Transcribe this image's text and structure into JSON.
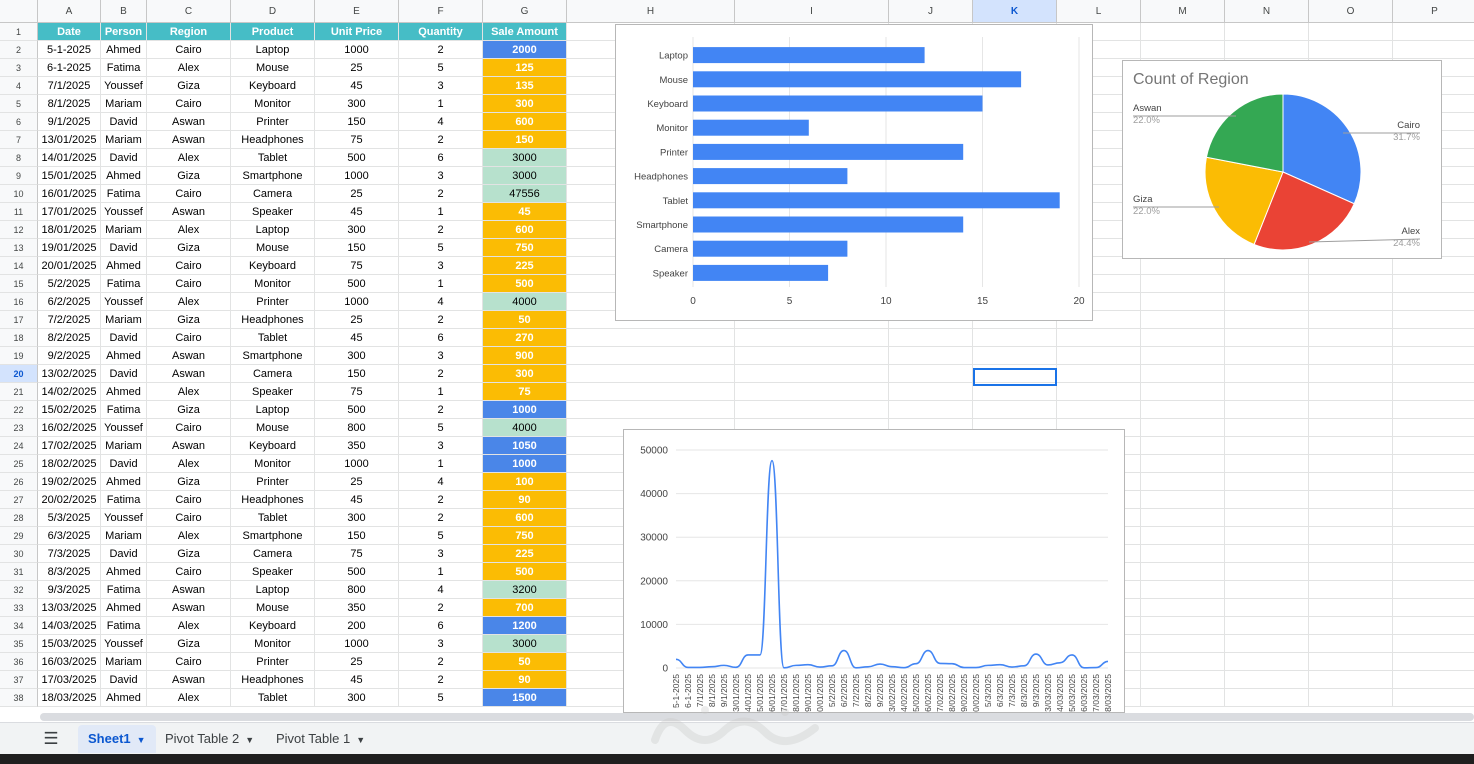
{
  "columns": [
    "A",
    "B",
    "C",
    "D",
    "E",
    "F",
    "G",
    "H",
    "I",
    "J",
    "K",
    "L",
    "M",
    "N",
    "O",
    "P"
  ],
  "selected_column": "K",
  "selected_row": "20",
  "headers": [
    "Date",
    "Person",
    "Region",
    "Product",
    "Unit Price",
    "Quantity",
    "Sale Amount"
  ],
  "rows": [
    {
      "date": "5-1-2025",
      "person": "Ahmed",
      "region": "Cairo",
      "product": "Laptop",
      "price": "1000",
      "qty": "2",
      "amount": "2000",
      "color": "blue"
    },
    {
      "date": "6-1-2025",
      "person": "Fatima",
      "region": "Alex",
      "product": "Mouse",
      "price": "25",
      "qty": "5",
      "amount": "125",
      "color": "orange"
    },
    {
      "date": "7/1/2025",
      "person": "Youssef",
      "region": "Giza",
      "product": "Keyboard",
      "price": "45",
      "qty": "3",
      "amount": "135",
      "color": "orange"
    },
    {
      "date": "8/1/2025",
      "person": "Mariam",
      "region": "Cairo",
      "product": "Monitor",
      "price": "300",
      "qty": "1",
      "amount": "300",
      "color": "orange"
    },
    {
      "date": "9/1/2025",
      "person": "David",
      "region": "Aswan",
      "product": "Printer",
      "price": "150",
      "qty": "4",
      "amount": "600",
      "color": "orange"
    },
    {
      "date": "13/01/2025",
      "person": "Mariam",
      "region": "Aswan",
      "product": "Headphones",
      "price": "75",
      "qty": "2",
      "amount": "150",
      "color": "orange"
    },
    {
      "date": "14/01/2025",
      "person": "David",
      "region": "Alex",
      "product": "Tablet",
      "price": "500",
      "qty": "6",
      "amount": "3000",
      "color": "green"
    },
    {
      "date": "15/01/2025",
      "person": "Ahmed",
      "region": "Giza",
      "product": "Smartphone",
      "price": "1000",
      "qty": "3",
      "amount": "3000",
      "color": "green"
    },
    {
      "date": "16/01/2025",
      "person": "Fatima",
      "region": "Cairo",
      "product": "Camera",
      "price": "25",
      "qty": "2",
      "amount": "47556",
      "color": "green"
    },
    {
      "date": "17/01/2025",
      "person": "Youssef",
      "region": "Aswan",
      "product": "Speaker",
      "price": "45",
      "qty": "1",
      "amount": "45",
      "color": "orange"
    },
    {
      "date": "18/01/2025",
      "person": "Mariam",
      "region": "Alex",
      "product": "Laptop",
      "price": "300",
      "qty": "2",
      "amount": "600",
      "color": "orange"
    },
    {
      "date": "19/01/2025",
      "person": "David",
      "region": "Giza",
      "product": "Mouse",
      "price": "150",
      "qty": "5",
      "amount": "750",
      "color": "orange"
    },
    {
      "date": "20/01/2025",
      "person": "Ahmed",
      "region": "Cairo",
      "product": "Keyboard",
      "price": "75",
      "qty": "3",
      "amount": "225",
      "color": "orange"
    },
    {
      "date": "5/2/2025",
      "person": "Fatima",
      "region": "Cairo",
      "product": "Monitor",
      "price": "500",
      "qty": "1",
      "amount": "500",
      "color": "orange"
    },
    {
      "date": "6/2/2025",
      "person": "Youssef",
      "region": "Alex",
      "product": "Printer",
      "price": "1000",
      "qty": "4",
      "amount": "4000",
      "color": "green"
    },
    {
      "date": "7/2/2025",
      "person": "Mariam",
      "region": "Giza",
      "product": "Headphones",
      "price": "25",
      "qty": "2",
      "amount": "50",
      "color": "orange"
    },
    {
      "date": "8/2/2025",
      "person": "David",
      "region": "Cairo",
      "product": "Tablet",
      "price": "45",
      "qty": "6",
      "amount": "270",
      "color": "orange"
    },
    {
      "date": "9/2/2025",
      "person": "Ahmed",
      "region": "Aswan",
      "product": "Smartphone",
      "price": "300",
      "qty": "3",
      "amount": "900",
      "color": "orange"
    },
    {
      "date": "13/02/2025",
      "person": "David",
      "region": "Aswan",
      "product": "Camera",
      "price": "150",
      "qty": "2",
      "amount": "300",
      "color": "orange"
    },
    {
      "date": "14/02/2025",
      "person": "Ahmed",
      "region": "Alex",
      "product": "Speaker",
      "price": "75",
      "qty": "1",
      "amount": "75",
      "color": "orange"
    },
    {
      "date": "15/02/2025",
      "person": "Fatima",
      "region": "Giza",
      "product": "Laptop",
      "price": "500",
      "qty": "2",
      "amount": "1000",
      "color": "blue"
    },
    {
      "date": "16/02/2025",
      "person": "Youssef",
      "region": "Cairo",
      "product": "Mouse",
      "price": "800",
      "qty": "5",
      "amount": "4000",
      "color": "green"
    },
    {
      "date": "17/02/2025",
      "person": "Mariam",
      "region": "Aswan",
      "product": "Keyboard",
      "price": "350",
      "qty": "3",
      "amount": "1050",
      "color": "blue"
    },
    {
      "date": "18/02/2025",
      "person": "David",
      "region": "Alex",
      "product": "Monitor",
      "price": "1000",
      "qty": "1",
      "amount": "1000",
      "color": "blue"
    },
    {
      "date": "19/02/2025",
      "person": "Ahmed",
      "region": "Giza",
      "product": "Printer",
      "price": "25",
      "qty": "4",
      "amount": "100",
      "color": "orange"
    },
    {
      "date": "20/02/2025",
      "person": "Fatima",
      "region": "Cairo",
      "product": "Headphones",
      "price": "45",
      "qty": "2",
      "amount": "90",
      "color": "orange"
    },
    {
      "date": "5/3/2025",
      "person": "Youssef",
      "region": "Cairo",
      "product": "Tablet",
      "price": "300",
      "qty": "2",
      "amount": "600",
      "color": "orange"
    },
    {
      "date": "6/3/2025",
      "person": "Mariam",
      "region": "Alex",
      "product": "Smartphone",
      "price": "150",
      "qty": "5",
      "amount": "750",
      "color": "orange"
    },
    {
      "date": "7/3/2025",
      "person": "David",
      "region": "Giza",
      "product": "Camera",
      "price": "75",
      "qty": "3",
      "amount": "225",
      "color": "orange"
    },
    {
      "date": "8/3/2025",
      "person": "Ahmed",
      "region": "Cairo",
      "product": "Speaker",
      "price": "500",
      "qty": "1",
      "amount": "500",
      "color": "orange"
    },
    {
      "date": "9/3/2025",
      "person": "Fatima",
      "region": "Aswan",
      "product": "Laptop",
      "price": "800",
      "qty": "4",
      "amount": "3200",
      "color": "green"
    },
    {
      "date": "13/03/2025",
      "person": "Ahmed",
      "region": "Aswan",
      "product": "Mouse",
      "price": "350",
      "qty": "2",
      "amount": "700",
      "color": "orange"
    },
    {
      "date": "14/03/2025",
      "person": "Fatima",
      "region": "Alex",
      "product": "Keyboard",
      "price": "200",
      "qty": "6",
      "amount": "1200",
      "color": "blue"
    },
    {
      "date": "15/03/2025",
      "person": "Youssef",
      "region": "Giza",
      "product": "Monitor",
      "price": "1000",
      "qty": "3",
      "amount": "3000",
      "color": "green"
    },
    {
      "date": "16/03/2025",
      "person": "Mariam",
      "region": "Cairo",
      "product": "Printer",
      "price": "25",
      "qty": "2",
      "amount": "50",
      "color": "orange"
    },
    {
      "date": "17/03/2025",
      "person": "David",
      "region": "Aswan",
      "product": "Headphones",
      "price": "45",
      "qty": "2",
      "amount": "90",
      "color": "orange"
    },
    {
      "date": "18/03/2025",
      "person": "Ahmed",
      "region": "Alex",
      "product": "Tablet",
      "price": "300",
      "qty": "5",
      "amount": "1500",
      "color": "blue"
    }
  ],
  "colors": {
    "blue": "#4a86e8",
    "orange": "#fbbc04",
    "green": "#b7e1cd",
    "header": "#46bdc6",
    "chart_blue": "#4285f4",
    "chart_red": "#ea4335",
    "chart_yellow": "#fbbc04",
    "chart_green": "#34a853"
  },
  "chart_data": [
    {
      "type": "bar",
      "orientation": "horizontal",
      "categories": [
        "Laptop",
        "Mouse",
        "Keyboard",
        "Monitor",
        "Printer",
        "Headphones",
        "Tablet",
        "Smartphone",
        "Camera",
        "Speaker"
      ],
      "values": [
        12,
        17,
        15,
        6,
        14,
        8,
        19,
        14,
        8,
        7
      ],
      "xlim": [
        0,
        20
      ],
      "xticks": [
        "0",
        "5",
        "10",
        "15",
        "20"
      ],
      "grid": true
    },
    {
      "type": "pie",
      "title": "Count of Region",
      "slices": [
        {
          "label": "Cairo",
          "percent_label": "31.7%",
          "value": 31.7,
          "color": "#4285f4"
        },
        {
          "label": "Alex",
          "percent_label": "24.4%",
          "value": 24.4,
          "color": "#ea4335"
        },
        {
          "label": "Giza",
          "percent_label": "22.0%",
          "value": 22.0,
          "color": "#fbbc04"
        },
        {
          "label": "Aswan",
          "percent_label": "22.0%",
          "value": 22.0,
          "color": "#34a853"
        }
      ]
    },
    {
      "type": "line",
      "smooth": true,
      "ylim": [
        0,
        50000
      ],
      "yticks": [
        "0",
        "10000",
        "20000",
        "30000",
        "40000",
        "50000"
      ],
      "x": [
        "5-1-2025",
        "6-1-2025",
        "7/1/2025",
        "8/1/2025",
        "9/1/2025",
        "13/01/2025",
        "14/01/2025",
        "15/01/2025",
        "16/01/2025",
        "17/01/2025",
        "18/01/2025",
        "19/01/2025",
        "20/01/2025",
        "5/2/2025",
        "6/2/2025",
        "7/2/2025",
        "8/2/2025",
        "9/2/2025",
        "13/02/2025",
        "14/02/2025",
        "15/02/2025",
        "16/02/2025",
        "17/02/2025",
        "18/02/2025",
        "19/02/2025",
        "20/02/2025",
        "5/3/2025",
        "6/3/2025",
        "7/3/2025",
        "8/3/2025",
        "9/3/2025",
        "13/03/2025",
        "14/03/2025",
        "15/03/2025",
        "16/03/2025",
        "17/03/2025",
        "18/03/2025"
      ],
      "values": [
        2000,
        125,
        135,
        300,
        600,
        150,
        3000,
        3000,
        47556,
        45,
        600,
        750,
        225,
        500,
        4000,
        50,
        270,
        900,
        300,
        75,
        1000,
        4000,
        1050,
        1000,
        100,
        90,
        600,
        750,
        225,
        500,
        3200,
        700,
        1200,
        3000,
        50,
        90,
        1500
      ],
      "grid": true
    }
  ],
  "sheet_tabs": {
    "menu_icon": "hamburger-icon",
    "tabs": [
      "Sheet1",
      "Pivot Table 2",
      "Pivot Table 1"
    ],
    "active": "Sheet1"
  }
}
